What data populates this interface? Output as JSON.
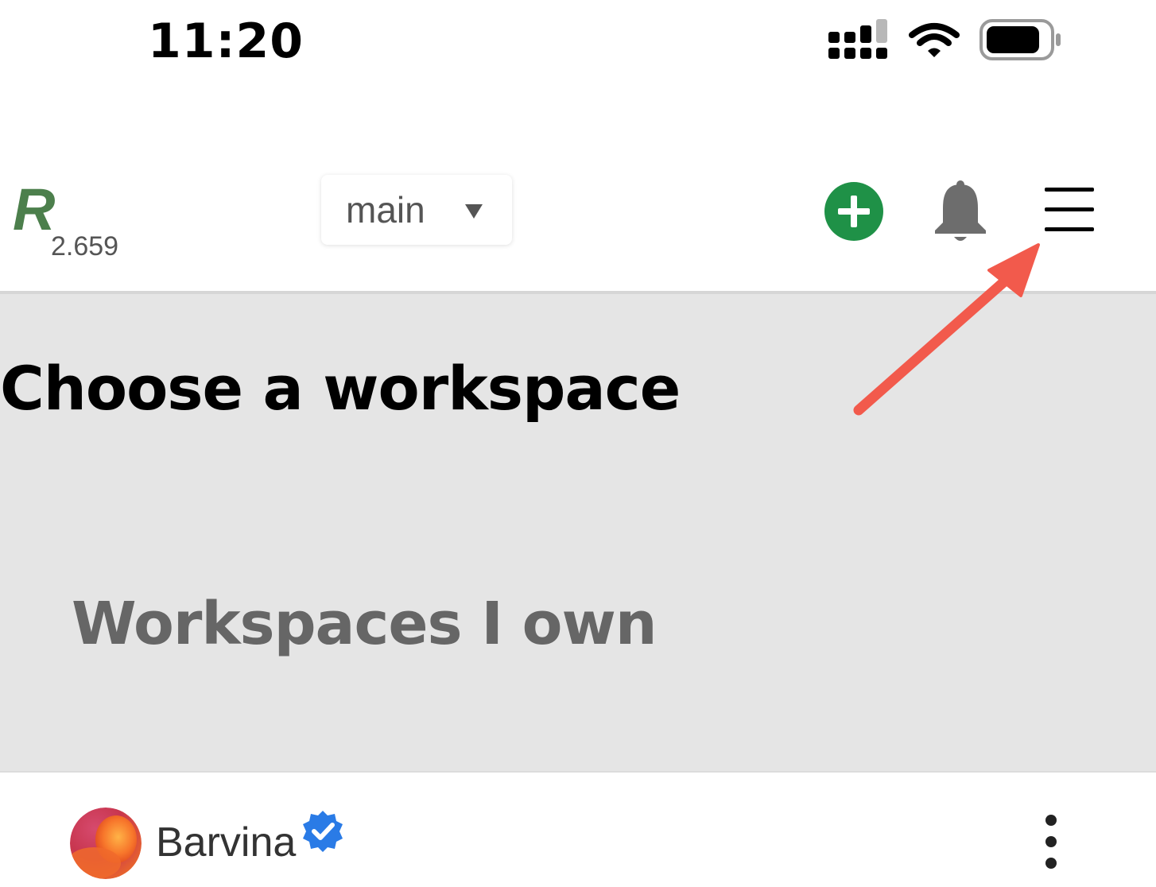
{
  "status_bar": {
    "time": "11:20"
  },
  "header": {
    "logo_letter": "R",
    "version": "2.659",
    "branch_select": {
      "selected": "main"
    }
  },
  "workspace_section": {
    "title": "Choose a workspace",
    "owned_heading": "Workspaces I own"
  },
  "workspaces": [
    {
      "name": "Barvina",
      "verified": true
    }
  ],
  "colors": {
    "logo_green": "#4c7f4c",
    "add_button_green": "#1f9147",
    "bell_grey": "#6d6d6d",
    "section_background": "#e5e5e5",
    "verified_blue": "#2a7be6",
    "annotation_red": "#f25a4c"
  },
  "icons": {
    "add": "plus-circle-icon",
    "notifications": "bell-icon",
    "menu": "hamburger-menu-icon",
    "more": "vertical-dots-icon",
    "verified": "verified-badge-icon",
    "dropdown": "caret-down-icon"
  }
}
